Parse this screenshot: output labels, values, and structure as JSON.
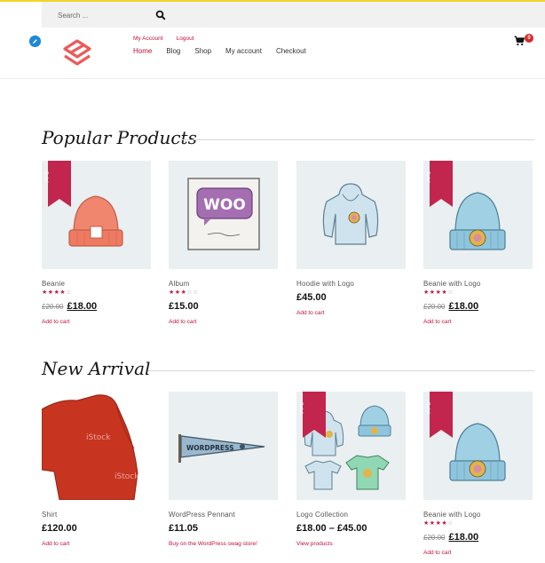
{
  "search": {
    "placeholder": "Search ..."
  },
  "header": {
    "util_links": [
      "My Account",
      "Logout"
    ],
    "nav": [
      "Home",
      "Blog",
      "Shop",
      "My account",
      "Checkout"
    ],
    "cart_count": "0"
  },
  "sections": [
    {
      "title": "Popular Products",
      "products": [
        {
          "name": "Beanie",
          "sale": "Sale!",
          "rating": 4,
          "old_price": "£20.00",
          "price": "£18.00",
          "action": "Add to cart",
          "image": "red-beanie"
        },
        {
          "name": "Album",
          "sale": "",
          "rating": 3,
          "old_price": "",
          "price": "£15.00",
          "action": "Add to cart",
          "image": "woo-album"
        },
        {
          "name": "Hoodie with Logo",
          "sale": "",
          "rating": 0,
          "old_price": "",
          "price": "£45.00",
          "action": "Add to cart",
          "image": "blue-hoodie"
        },
        {
          "name": "Beanie with Logo",
          "sale": "Sale!",
          "rating": 4,
          "old_price": "£20.00",
          "price": "£18.00",
          "action": "Add to cart",
          "image": "blue-beanie"
        }
      ]
    },
    {
      "title": "New Arrival",
      "products": [
        {
          "name": "Shirt",
          "sale": "",
          "rating": 0,
          "old_price": "",
          "price": "£120.00",
          "action": "Add to cart",
          "image": "red-sweater"
        },
        {
          "name": "WordPress Pennant",
          "sale": "",
          "rating": 0,
          "old_price": "",
          "price": "£11.05",
          "action": "Buy on the WordPress swag store!",
          "image": "pennant"
        },
        {
          "name": "Logo Collection",
          "sale": "Sale!",
          "rating": 0,
          "old_price": "",
          "price": "£18.00 – £45.00",
          "action": "View products",
          "image": "collection"
        },
        {
          "name": "Beanie with Logo",
          "sale": "Sale!",
          "rating": 4,
          "old_price": "£20.00",
          "price": "£18.00",
          "action": "Add to cart",
          "image": "blue-beanie"
        }
      ]
    }
  ],
  "colors": {
    "accent": "#c0123c",
    "sale": "#c2264e",
    "top_strip": "#f2d624",
    "cart_badge": "#d52b2b"
  }
}
